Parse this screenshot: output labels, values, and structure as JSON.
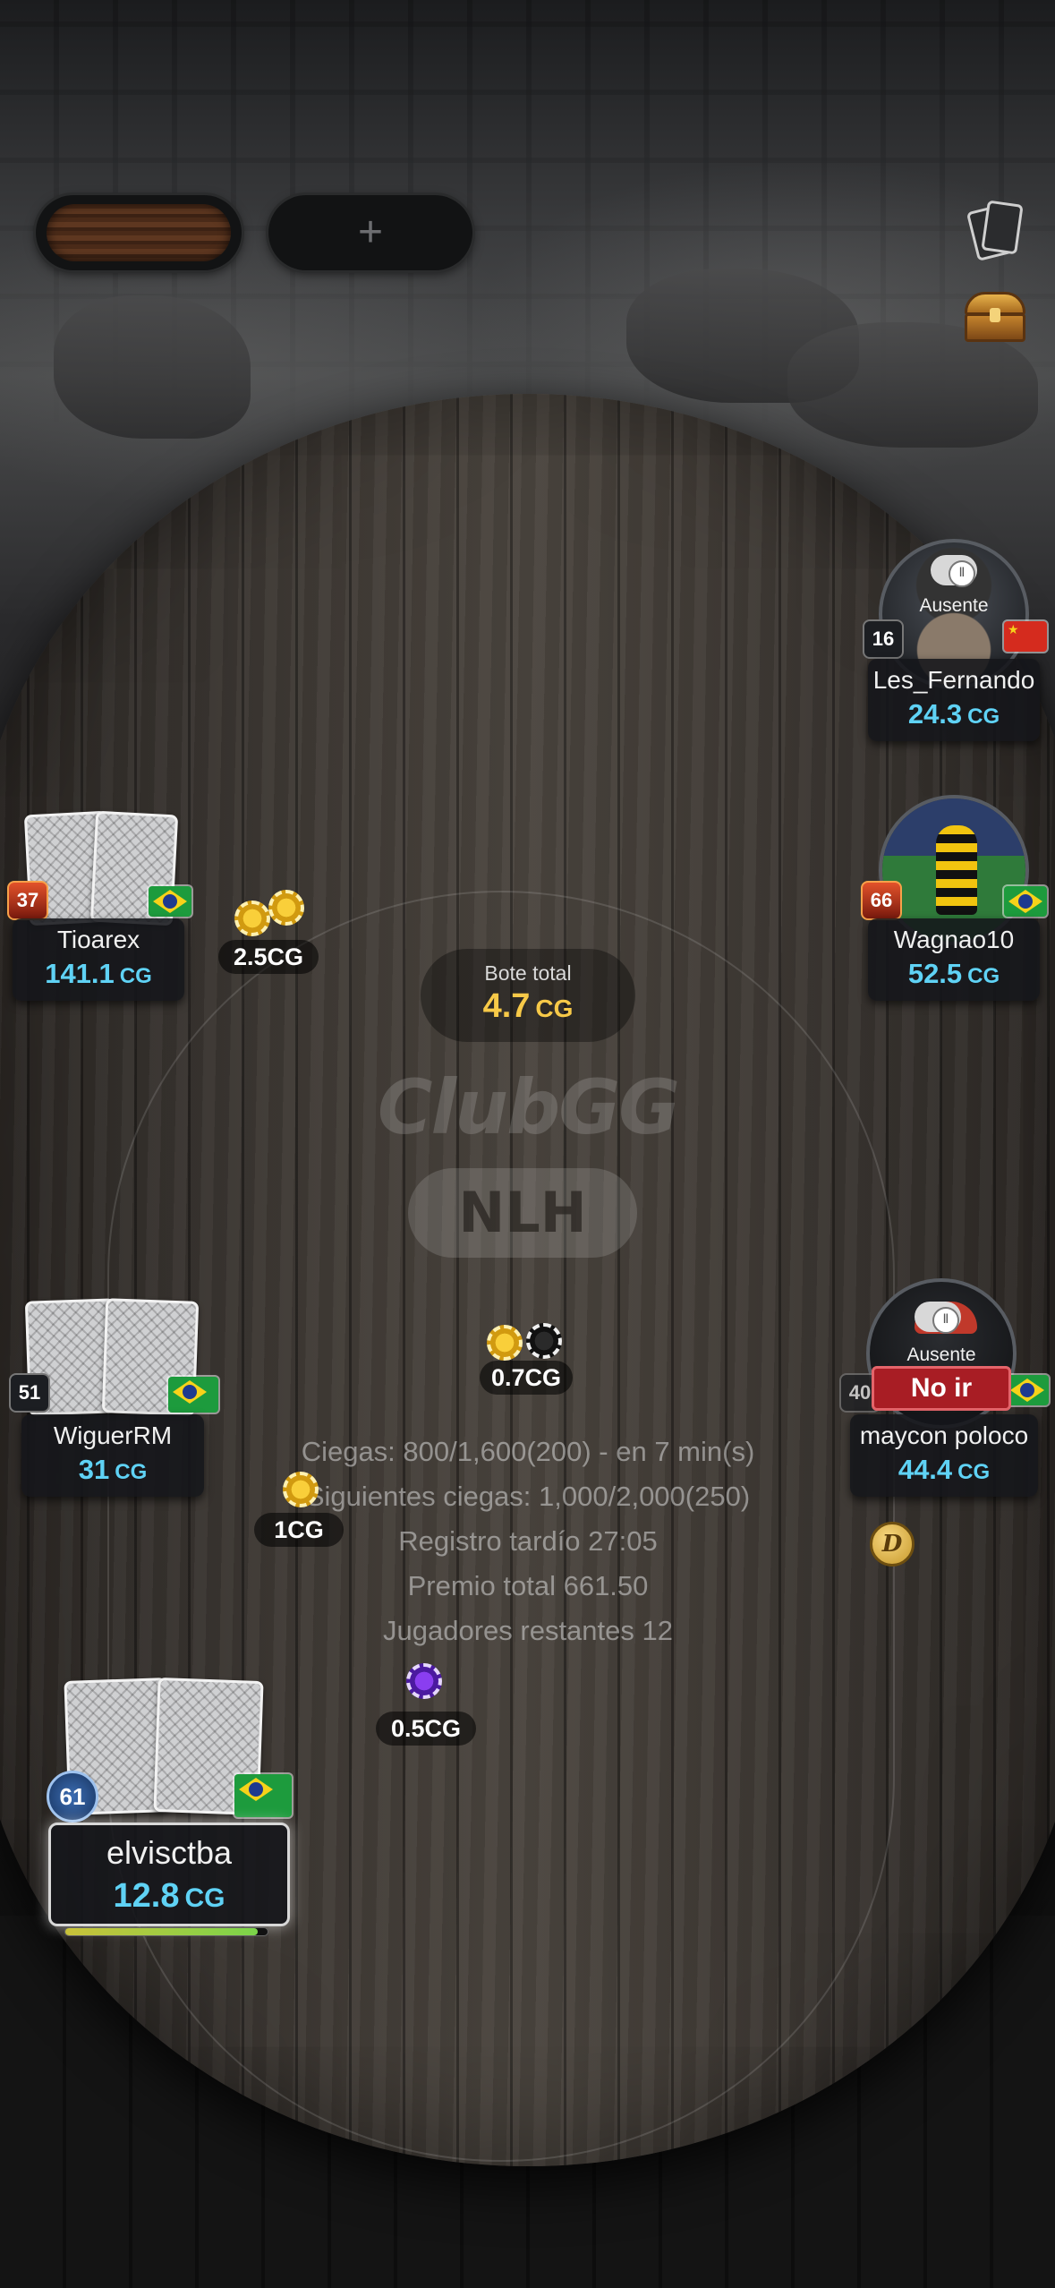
{
  "toolbar": {
    "add_table_label": "+"
  },
  "table": {
    "watermark": "ClubGG",
    "variant": "NLH",
    "pot_label": "Bote total",
    "pot_value": "4.7",
    "pot_unit": "CG"
  },
  "tournament_info": {
    "blinds": "Ciegas: 800/1,600(200) - en 7 min(s)",
    "next_blinds": "Siguientes ciegas: 1,000/2,000(250)",
    "late_registration": "Registro tardío 27:05",
    "prize_pool": "Premio total 661.50",
    "players_remaining": "Jugadores restantes 12"
  },
  "players": [
    {
      "seat": "top-right",
      "name": "Les_Fernando",
      "stack": "24.3",
      "unit": "CG",
      "level": "16",
      "flag": "china",
      "status": "Ausente"
    },
    {
      "seat": "left-upper",
      "name": "Tioarex",
      "stack": "141.1",
      "unit": "CG",
      "level": "37",
      "flag": "brazil",
      "bet": "2.5CG"
    },
    {
      "seat": "right-upper",
      "name": "Wagnao10",
      "stack": "52.5",
      "unit": "CG",
      "level": "66",
      "flag": "brazil"
    },
    {
      "seat": "left-lower",
      "name": "WiguerRM",
      "stack": "31",
      "unit": "CG",
      "level": "51",
      "flag": "brazil",
      "bet": "1CG"
    },
    {
      "seat": "right-lower",
      "name": "maycon poloco",
      "stack": "44.4",
      "unit": "CG",
      "level": "40",
      "flag": "brazil",
      "status": "Ausente",
      "action": "No ir",
      "bet": "0.7CG",
      "dealer": "D"
    },
    {
      "seat": "hero",
      "name": "elvisctba",
      "stack": "12.8",
      "unit": "CG",
      "level": "61",
      "flag": "brazil",
      "bet": "0.5CG",
      "timer_fraction": 0.95
    }
  ],
  "colors": {
    "stack": "#5fd2f5",
    "pot": "#f7c948",
    "fold_tag": "#a81d24"
  }
}
